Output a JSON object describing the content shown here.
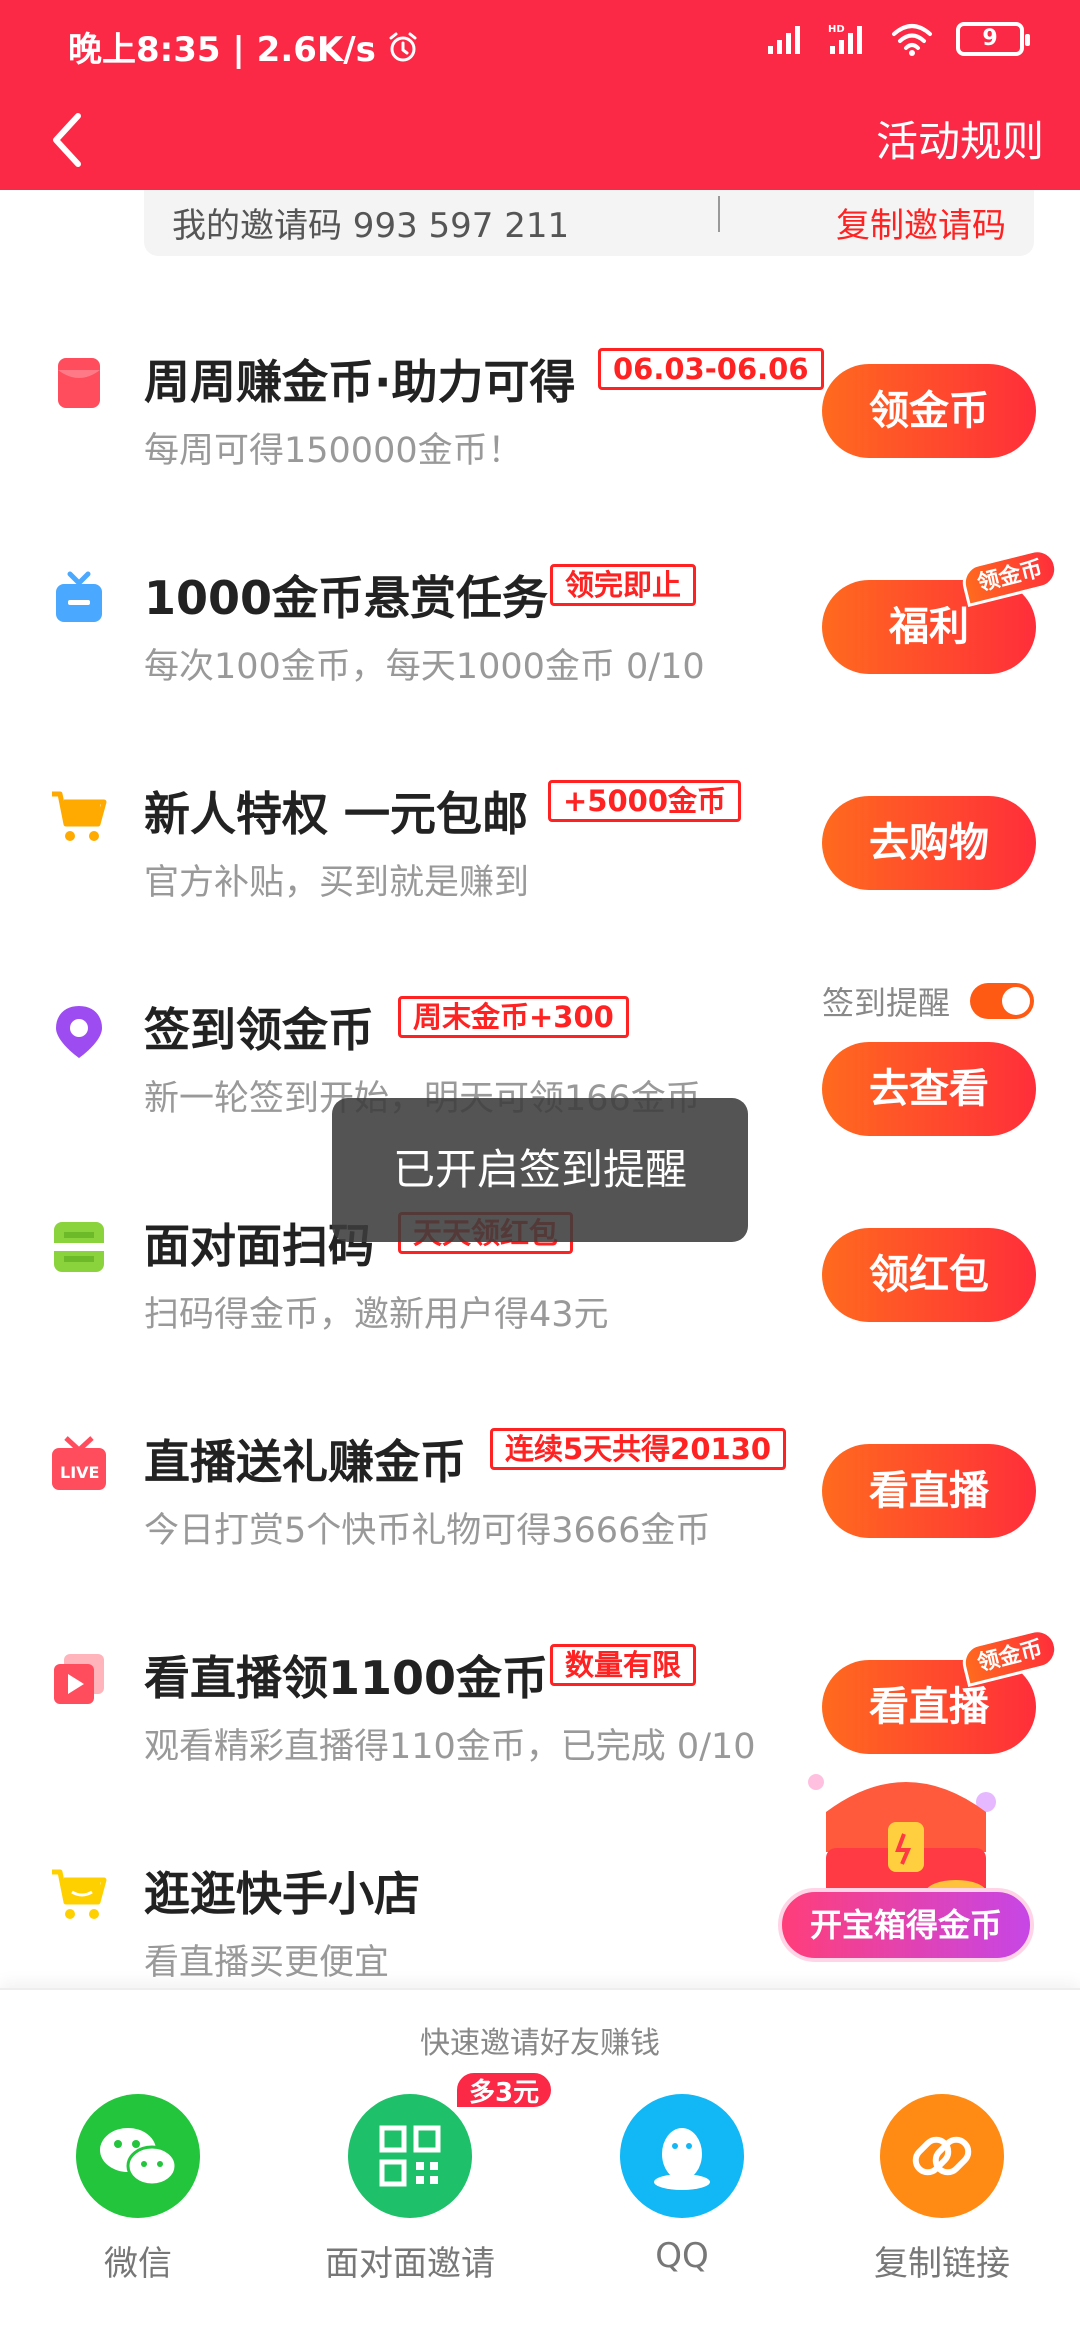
{
  "status_bar": {
    "time_speed": "晚上8:35 | 2.6K/s",
    "battery": "9"
  },
  "header": {
    "rules_label": "活动规则"
  },
  "invite": {
    "code_text": "我的邀请码 993 597 211",
    "copy_label": "复制邀请码"
  },
  "tasks": [
    {
      "title": "周周赚金币·助力可得",
      "tag": "06.03-06.06",
      "desc": "每周可得150000金币！",
      "button": "领金币",
      "icon": "red-envelope-icon"
    },
    {
      "title": "1000金币悬赏任务",
      "tag": "领完即止",
      "desc": "每次100金币，每天1000金币 0/10",
      "button": "福利",
      "badge": "领金币",
      "icon": "tv-icon"
    },
    {
      "title": "新人特权 一元包邮",
      "tag": "+5000金币",
      "desc": "官方补贴，买到就是赚到",
      "button": "去购物",
      "icon": "shopping-cart-icon"
    },
    {
      "title": "签到领金币",
      "tag": "周末金币+300",
      "desc": "新一轮签到开始，明天可领166金币",
      "button": "去查看",
      "icon": "location-pin-icon"
    },
    {
      "title": "面对面扫码",
      "tag": "天天领红包",
      "desc": "扫码得金币，邀新用户得43元",
      "button": "领红包",
      "icon": "scan-icon"
    },
    {
      "title": "直播送礼赚金币",
      "tag": "连续5天共得20130",
      "desc": "今日打赏5个快币礼物可得3666金币",
      "button": "看直播",
      "icon": "live-gift-icon"
    },
    {
      "title": "看直播领1100金币",
      "tag": "数量有限",
      "desc": "观看精彩直播得110金币，已完成 0/10",
      "button": "看直播",
      "badge": "领金币",
      "icon": "play-icon"
    },
    {
      "title": "逛逛快手小店",
      "desc": "看直播买更便宜",
      "icon": "cart-icon"
    }
  ],
  "reminder": {
    "label": "签到提醒",
    "enabled": true
  },
  "toast": "已开启签到提醒",
  "chest": {
    "button": "开宝箱得金币"
  },
  "share": {
    "title": "快速邀请好友赚钱",
    "items": [
      {
        "label": "微信",
        "color": "#22c53c"
      },
      {
        "label": "面对面邀请",
        "color": "#1ec06a",
        "badge": "多3元"
      },
      {
        "label": "QQ",
        "color": "#12b7f5"
      },
      {
        "label": "复制链接",
        "color": "#ff8a14"
      }
    ]
  },
  "colors": {
    "brand": "#fb2846",
    "button_gradient_start": "#ff6a1e",
    "button_gradient_end": "#ff2e3a",
    "tag_red": "#f22"
  }
}
